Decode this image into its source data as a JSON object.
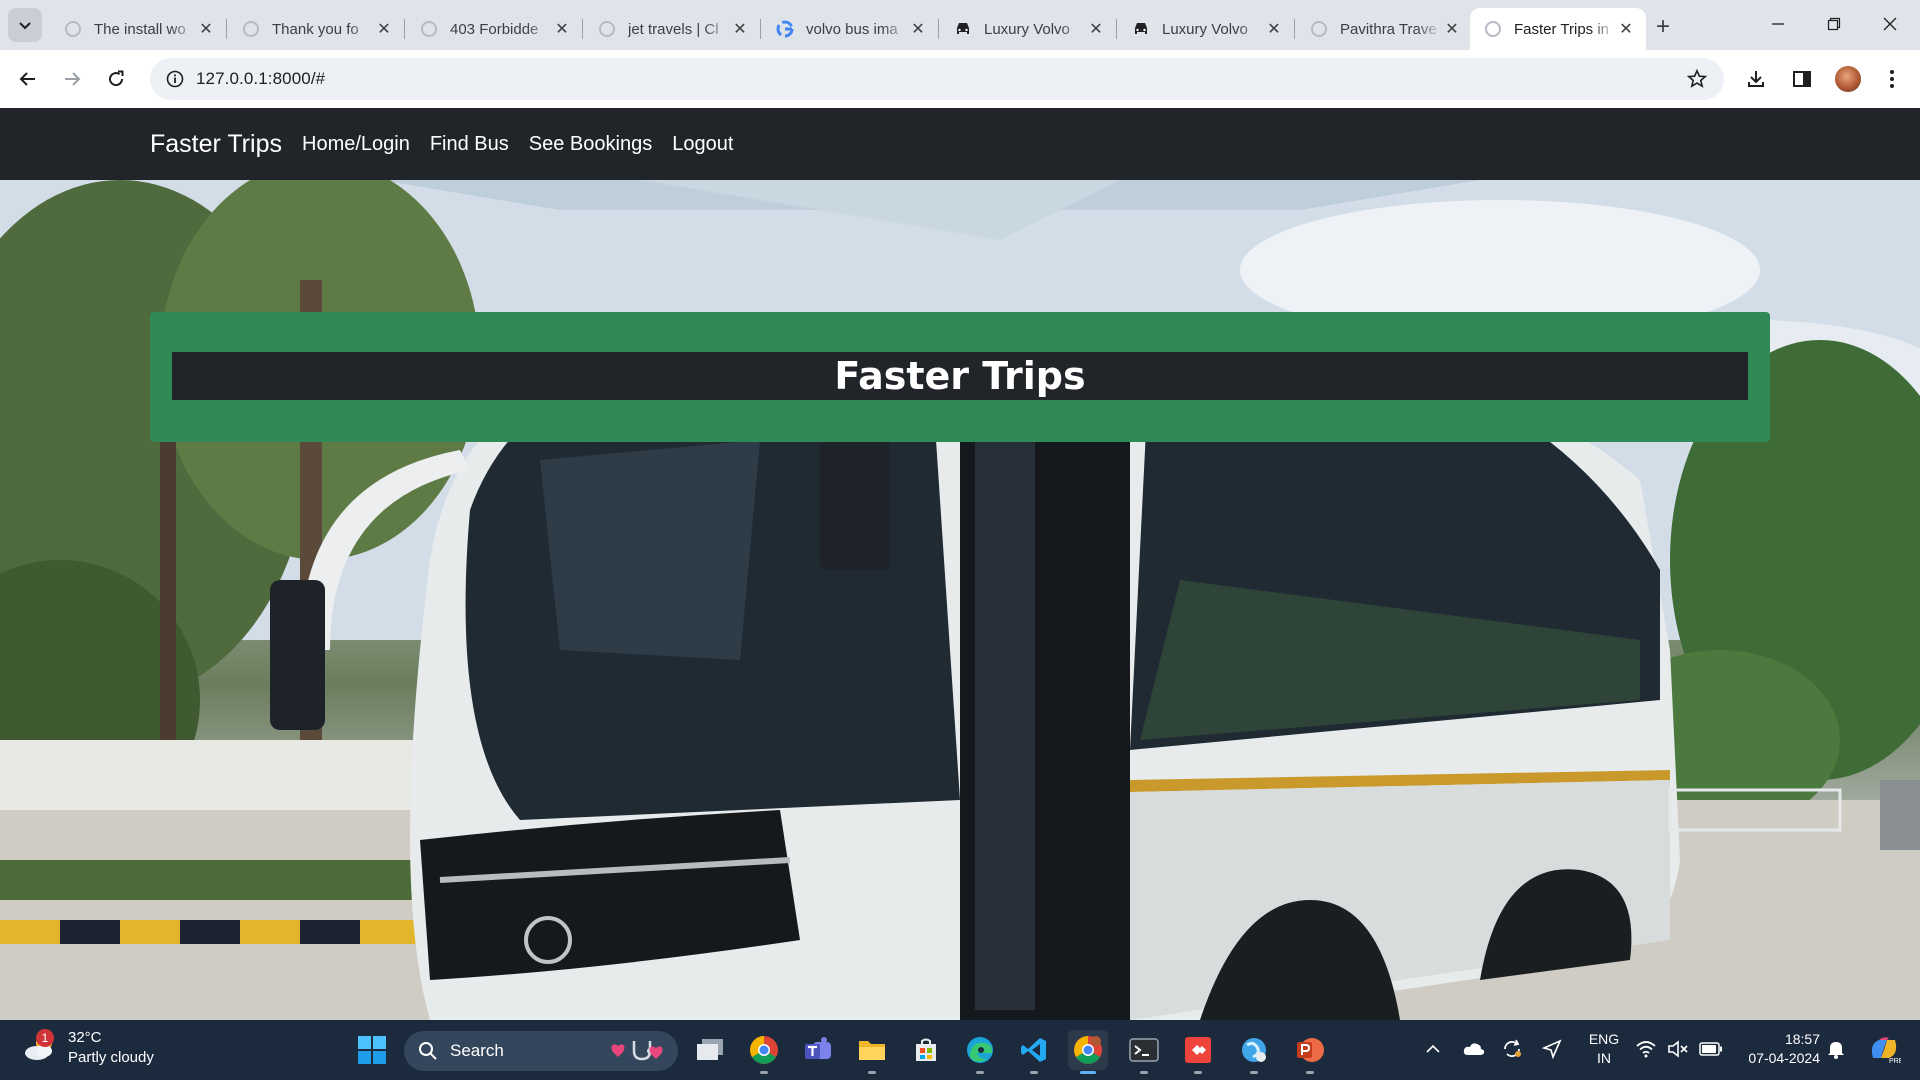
{
  "browser": {
    "tabs": [
      {
        "title": "The install wo",
        "favicon": "globe-icon",
        "active": false
      },
      {
        "title": "Thank you fo",
        "favicon": "globe-icon",
        "active": false
      },
      {
        "title": "403 Forbidde",
        "favicon": "globe-icon",
        "active": false
      },
      {
        "title": "jet travels | Cl",
        "favicon": "globe-icon",
        "active": false
      },
      {
        "title": "volvo bus ima",
        "favicon": "google-icon",
        "active": false
      },
      {
        "title": "Luxury Volvo",
        "favicon": "car-icon",
        "active": false
      },
      {
        "title": "Luxury Volvo",
        "favicon": "car-icon",
        "active": false
      },
      {
        "title": "Pavithra Trave",
        "favicon": "globe-icon",
        "active": false
      },
      {
        "title": "Faster Trips in",
        "favicon": "globe-icon",
        "active": true
      }
    ],
    "url": "127.0.0.1:8000/#"
  },
  "site": {
    "brand": "Faster Trips",
    "nav": [
      "Home/Login",
      "Find Bus",
      "See Bookings",
      "Logout"
    ],
    "banner_title": "Faster Trips"
  },
  "taskbar": {
    "weather_temp": "32°C",
    "weather_desc": "Partly cloudy",
    "weather_badge": "1",
    "search_label": "Search",
    "lang_line1": "ENG",
    "lang_line2": "IN",
    "time": "18:57",
    "date": "07-04-2024"
  },
  "colors": {
    "navbar": "#212529",
    "banner_green": "#2f8a57",
    "taskbar": "#1c2a3d"
  }
}
